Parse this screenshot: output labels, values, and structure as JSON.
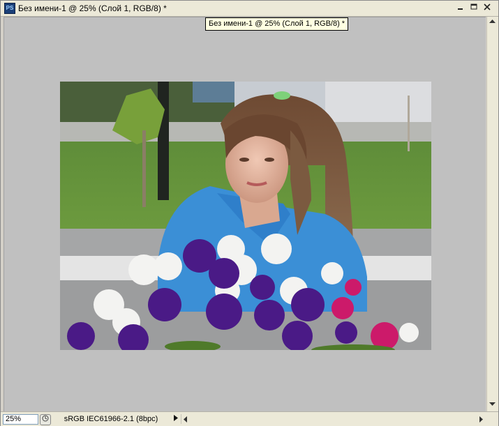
{
  "window": {
    "title": "Без имени-1 @ 25% (Слой 1, RGB/8) *",
    "app_icon": "PS"
  },
  "tooltip": "Без имени-1 @ 25% (Слой 1, RGB/8) *",
  "status": {
    "zoom": "25%",
    "doc_info": "sRGB IEC61966-2.1 (8bpc)"
  },
  "icons": {
    "minimize": "minimize-icon",
    "maximize": "maximize-icon",
    "close": "close-icon",
    "status_menu": "triangle-right-icon"
  }
}
